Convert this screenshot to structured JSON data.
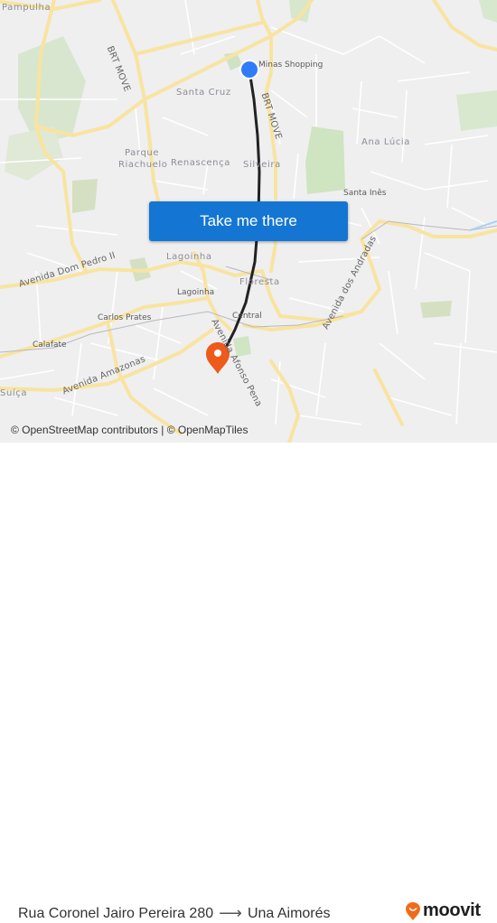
{
  "map": {
    "labels": {
      "pampulha": "Pampulha",
      "brt_move_1": "BRT MOVE",
      "brt_move_2": "BRT MOVE",
      "minas_shopping": "Minas Shopping",
      "santa_cruz": "Santa Cruz",
      "ana_lucia": "Ana Lúcia",
      "parque_riachuelo_1": "Parque",
      "parque_riachuelo_2": "Riachuelo",
      "renascenca": "Renascença",
      "silveira": "Silveira",
      "santa_ines": "Santa Inês",
      "avenida_dom_pedro_ii": "Avenida Dom Pedro II",
      "lagoinha_1": "Lagoinha",
      "lagoinha_2": "Lagoinha",
      "floresta": "Floresta",
      "avenida_dos_andradas": "Avenida dos Andradas",
      "carlos_prates": "Carlos Prates",
      "central": "Central",
      "calafate": "Calafate",
      "avenida_amazonas": "Avenida Amazonas",
      "avenida_afonso_pena": "Avenida Afonso Pena",
      "suica": "Suíça"
    },
    "route_color": "#222222",
    "origin_color": "#2f7cf6",
    "destination_color": "#ee5a1c",
    "cta_label": "Take me there",
    "attribution": "© OpenStreetMap contributors | © OpenMapTiles"
  },
  "footer": {
    "origin": "Rua Coronel Jairo Pereira 280",
    "arrow": "⟶",
    "destination": "Una Aimorés",
    "brand": "moovit",
    "brand_color": "#f26a1b"
  }
}
